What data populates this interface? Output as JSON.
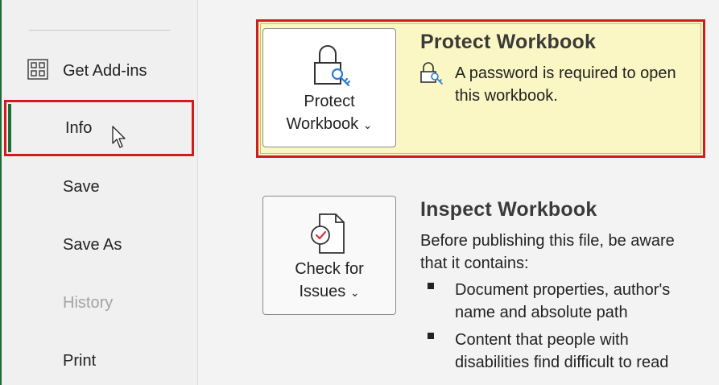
{
  "sidebar": {
    "items": [
      {
        "id": "get-addins",
        "label": "Get Add-ins",
        "icon": "grid-icon"
      },
      {
        "id": "info",
        "label": "Info",
        "selected": true
      },
      {
        "id": "save",
        "label": "Save"
      },
      {
        "id": "save-as",
        "label": "Save As"
      },
      {
        "id": "history",
        "label": "History",
        "disabled": true
      },
      {
        "id": "print",
        "label": "Print"
      }
    ]
  },
  "protect": {
    "button_line1": "Protect",
    "button_line2": "Workbook",
    "button_icon": "lock-key-icon",
    "title": "Protect Workbook",
    "desc_line1": "A password is required to open",
    "desc_line2": "this workbook.",
    "status_icon": "small-lock-icon"
  },
  "inspect": {
    "button_line1": "Check for",
    "button_line2": "Issues",
    "button_icon": "document-check-icon",
    "title": "Inspect Workbook",
    "desc_line1": "Before publishing this file, be aware",
    "desc_line2": "that it contains:",
    "bullets": [
      {
        "line1": "Document properties, author's",
        "line2": "name and absolute path"
      },
      {
        "line1": "Content that people with",
        "line2": "disabilities find difficult to read"
      }
    ]
  },
  "colors": {
    "accent_green": "#1e6b35",
    "highlight_red": "#d01c1c",
    "protect_bg": "#fbf7c4",
    "icon_blue": "#2b7cd3",
    "check_red": "#d13438"
  }
}
